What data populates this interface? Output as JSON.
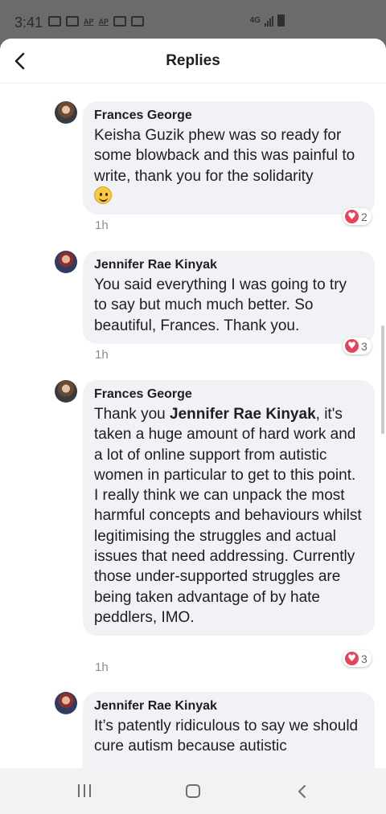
{
  "status_bar": {
    "time": "3:41",
    "network": "4G"
  },
  "header": {
    "title": "Replies",
    "back_icon": "chevron-left-icon"
  },
  "comments": [
    {
      "author": "Frances George",
      "text": "Keisha Guzik phew was so ready for some blowback and this was painful to write, thank you for the solidarity",
      "emoji": "slightly-smiling-face-emoji",
      "time": "1h",
      "reaction_count": "2"
    },
    {
      "author": "Jennifer Rae Kinyak",
      "text": "You said everything I was going to try to say but much much better. So beautiful, Frances. Thank you.",
      "time": "1h",
      "reaction_count": "3"
    },
    {
      "author": "Frances George",
      "text_before": "Thank you ",
      "mention": "Jennifer Rae Kinyak",
      "text_after": ", it's taken a huge amount of hard work and a lot of online support from autistic women in particular to get to this point. I really think we can unpack the most harmful concepts and behaviours whilst legitimising the struggles and actual issues that need addressing. Currently those under-supported struggles are being taken advantage of by hate peddlers, IMO.",
      "time": "1h",
      "reaction_count": "3"
    },
    {
      "author": "Jennifer Rae Kinyak",
      "text": "It’s patently ridiculous to say we should cure autism because autistic"
    }
  ],
  "colors": {
    "bubble": "#f0f2f5",
    "heart": "#e8425a",
    "text": "#1c1e21",
    "muted": "#8a8d91"
  }
}
